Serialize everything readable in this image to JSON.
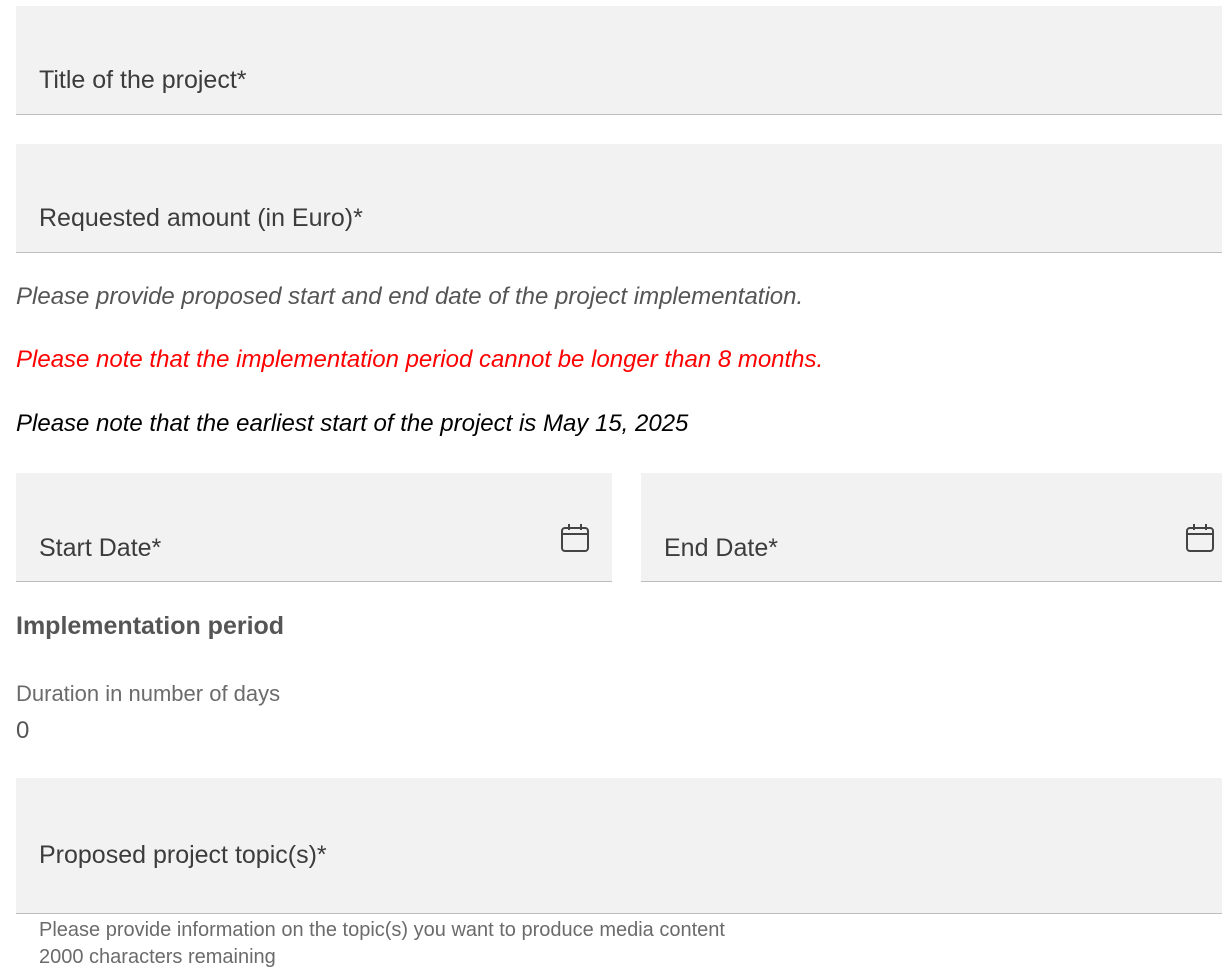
{
  "form": {
    "title_field": {
      "label": "Title of the project*"
    },
    "amount_field": {
      "label": "Requested amount (in Euro)*"
    },
    "notes": {
      "provide_dates": "Please provide proposed start and end date of the project implementation.",
      "max_period": "Please note that the implementation period cannot be longer than 8 months.",
      "earliest_start": "Please note that the earliest start of the project is May 15, 2025"
    },
    "start_date": {
      "label": "Start Date*",
      "icon": "calendar-icon"
    },
    "end_date": {
      "label": "End Date*",
      "icon": "calendar-icon"
    },
    "implementation": {
      "title": "Implementation period",
      "duration_label": "Duration in number of days",
      "duration_value": "0"
    },
    "topic_field": {
      "label": "Proposed project topic(s)*",
      "helper": "Please provide information on the topic(s) you want to produce media content",
      "counter": "2000 characters remaining"
    }
  },
  "colors": {
    "field_bg": "#f2f2f2",
    "warning_red": "#ff0000",
    "muted_text": "#6b6b6b"
  }
}
